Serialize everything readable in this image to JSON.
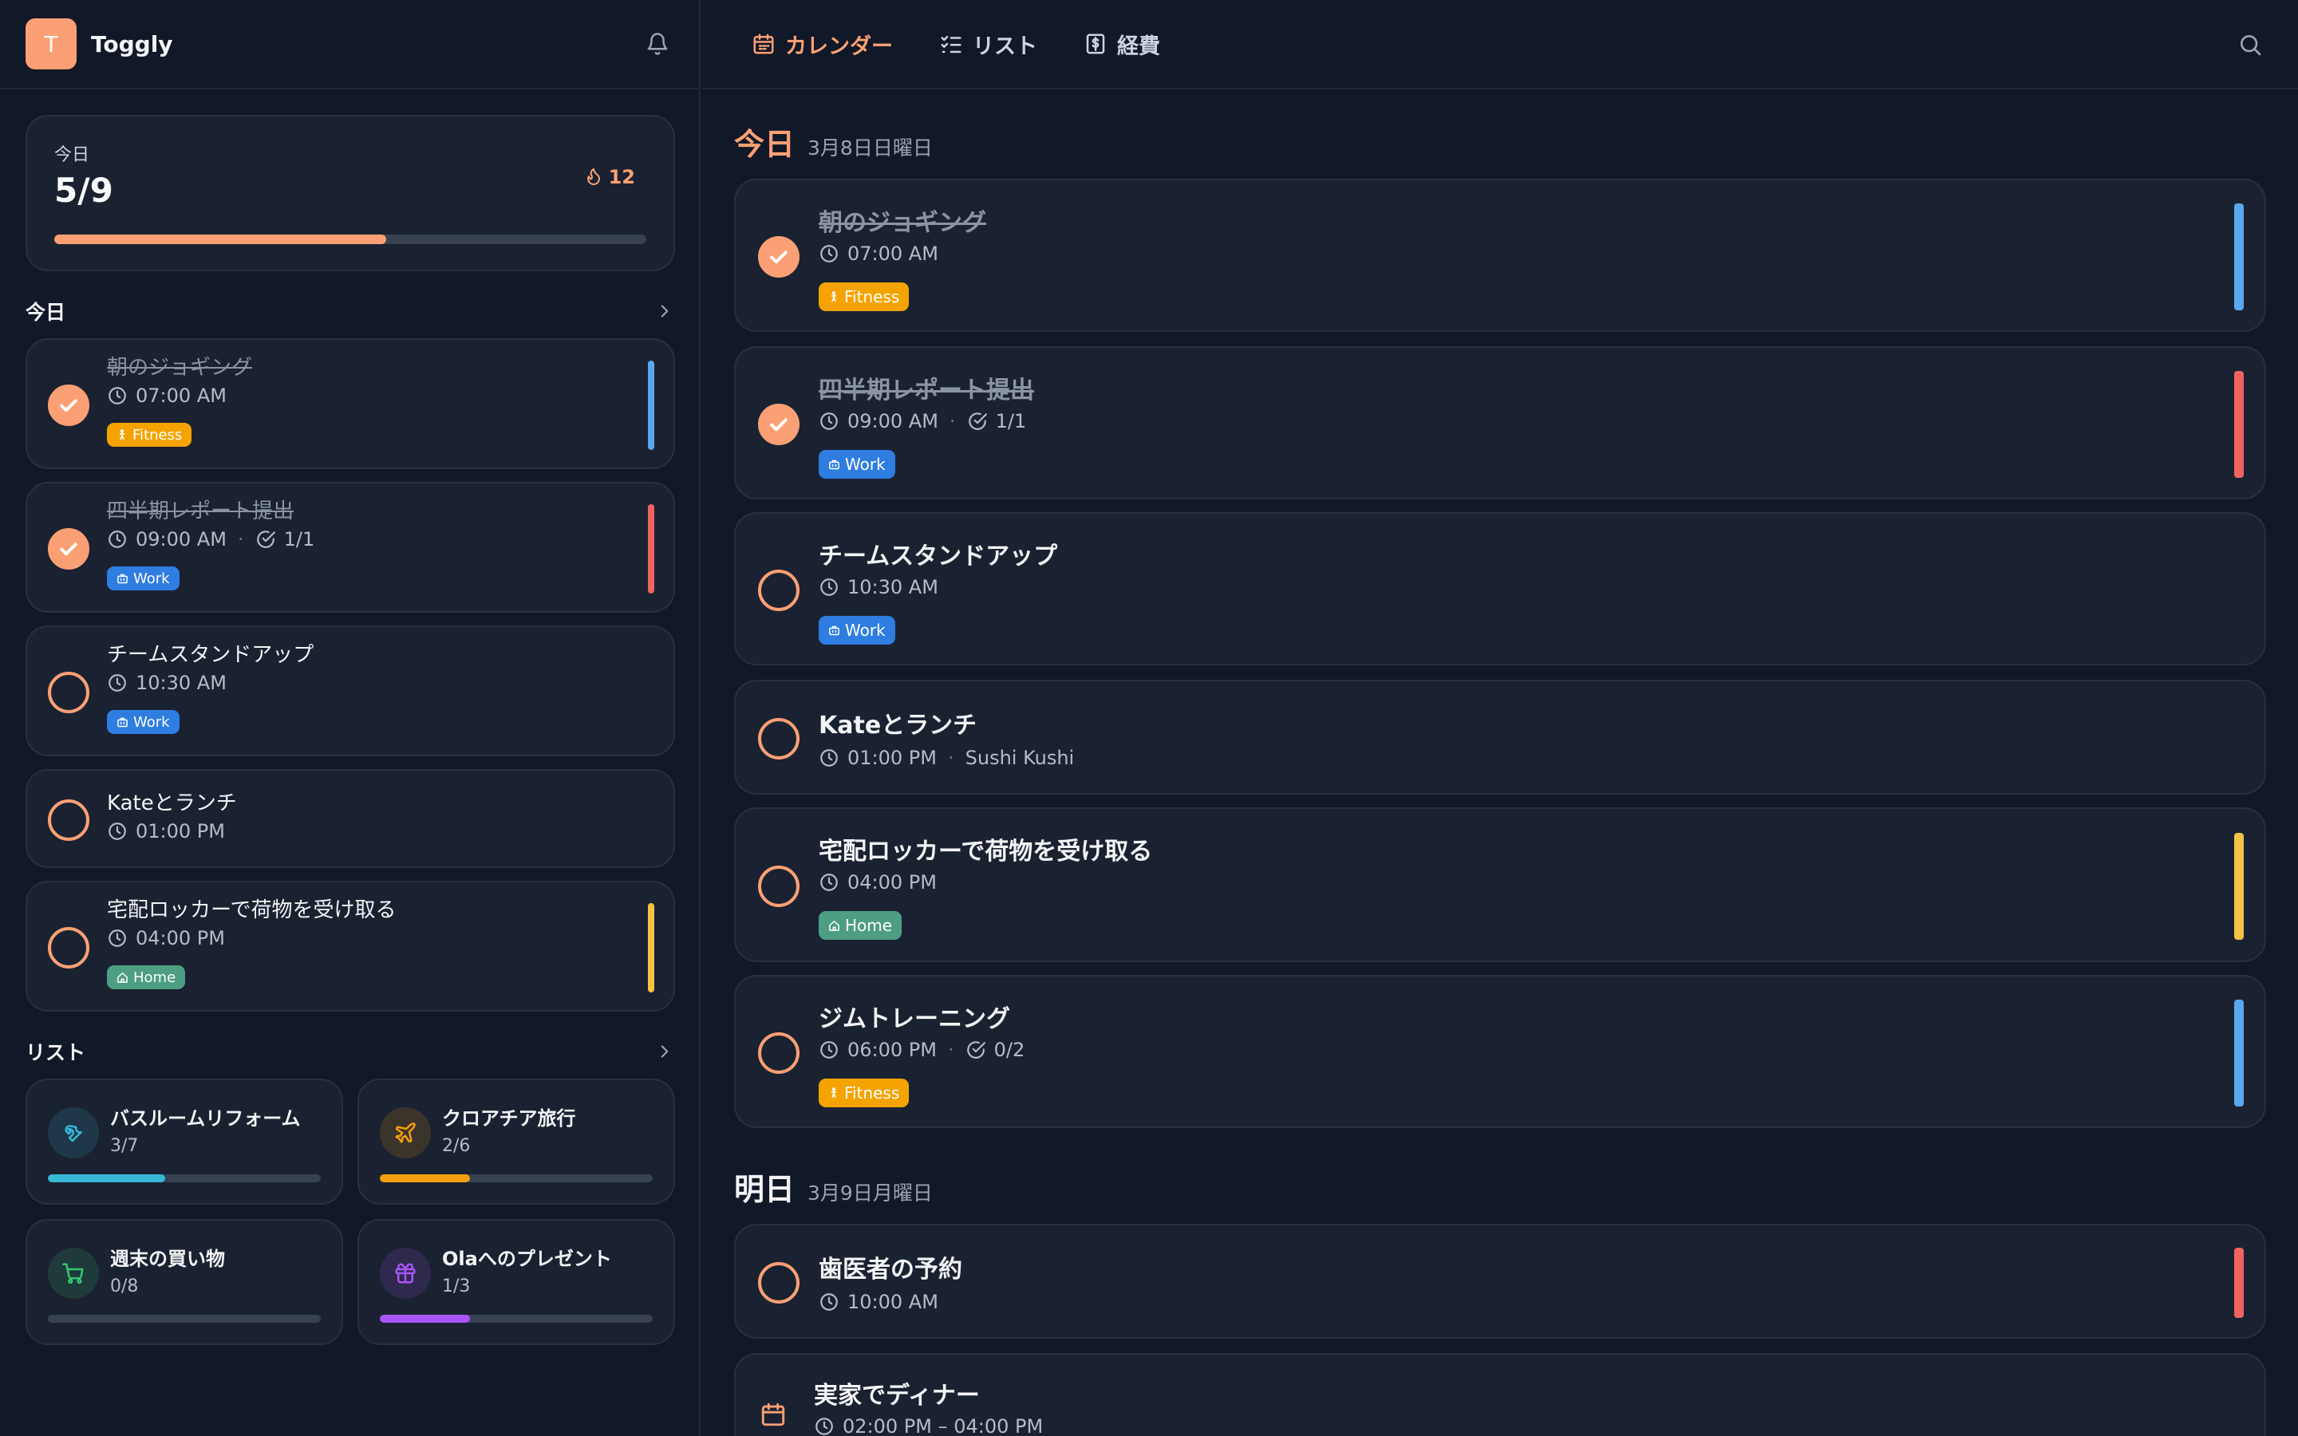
{
  "app": {
    "logo_letter": "T",
    "name": "Toggly"
  },
  "summary": {
    "label": "今日",
    "value": "5/9",
    "streak": "12",
    "progress": 0.56
  },
  "sidebar": {
    "today_title": "今日",
    "lists_title": "リスト",
    "tasks": [
      {
        "title": "朝のジョギング",
        "time": "07:00 AM",
        "tag": "Fitness",
        "done": true,
        "accent": "#5aa7ee"
      },
      {
        "title": "四半期レポート提出",
        "time": "09:00 AM",
        "sub": "1/1",
        "tag": "Work",
        "done": true,
        "accent": "#ef6461"
      },
      {
        "title": "チームスタンドアップ",
        "time": "10:30 AM",
        "tag": "Work",
        "done": false
      },
      {
        "title": "Kateとランチ",
        "time": "01:00 PM",
        "done": false
      },
      {
        "title": "宅配ロッカーで荷物を受け取る",
        "time": "04:00 PM",
        "tag": "Home",
        "done": false,
        "accent": "#f6c244"
      }
    ],
    "lists": [
      {
        "title": "バスルームリフォーム",
        "count": "3/7",
        "progress": 0.43,
        "icon": "wrench-icon",
        "color": "#36b8d6"
      },
      {
        "title": "クロアチア旅行",
        "count": "2/6",
        "progress": 0.33,
        "icon": "plane-icon",
        "color": "#f59e0b"
      },
      {
        "title": "週末の買い物",
        "count": "0/8",
        "progress": 0.0,
        "icon": "cart-icon",
        "color": "#34c770"
      },
      {
        "title": "Olaへのプレゼント",
        "count": "1/3",
        "progress": 0.33,
        "icon": "gift-icon",
        "color": "#a855f7"
      }
    ]
  },
  "tabs": [
    {
      "label": "カレンダー",
      "icon": "calendar-icon",
      "active": true
    },
    {
      "label": "リスト",
      "icon": "checklist-icon",
      "active": false
    },
    {
      "label": "経費",
      "icon": "expense-icon",
      "active": false
    }
  ],
  "main": {
    "today": {
      "label": "今日",
      "date": "3月8日日曜日"
    },
    "tomorrow": {
      "label": "明日",
      "date": "3月9日月曜日"
    },
    "today_tasks": [
      {
        "title": "朝のジョギング",
        "time": "07:00 AM",
        "tag": "Fitness",
        "done": true,
        "accent": "#5aa7ee"
      },
      {
        "title": "四半期レポート提出",
        "time": "09:00 AM",
        "sub": "1/1",
        "tag": "Work",
        "done": true,
        "accent": "#ef6461"
      },
      {
        "title": "チームスタンドアップ",
        "time": "10:30 AM",
        "tag": "Work",
        "done": false
      },
      {
        "title": "Kateとランチ",
        "time": "01:00 PM",
        "location": "Sushi Kushi",
        "done": false
      },
      {
        "title": "宅配ロッカーで荷物を受け取る",
        "time": "04:00 PM",
        "tag": "Home",
        "done": false,
        "accent": "#f6c244"
      },
      {
        "title": "ジムトレーニング",
        "time": "06:00 PM",
        "sub": "0/2",
        "tag": "Fitness",
        "done": false,
        "accent": "#5aa7ee"
      }
    ],
    "tomorrow_tasks": [
      {
        "title": "歯医者の予約",
        "time": "10:00 AM",
        "done": false,
        "accent": "#ef6461"
      },
      {
        "title": "実家でディナー",
        "time": "02:00 PM – 04:00 PM",
        "event": true
      }
    ]
  },
  "colors": {
    "accent": "#fba074",
    "fitness": "#f5a300",
    "work": "#2f7de1",
    "home": "#4d9e82"
  }
}
